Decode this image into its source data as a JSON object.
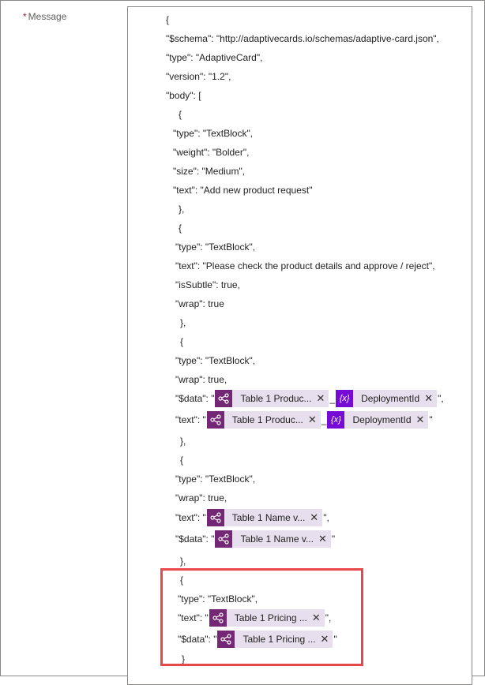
{
  "field": {
    "required_mark": "*",
    "label": "Message"
  },
  "lines": {
    "l1": "{",
    "l2": "\"$schema\": \"http://adaptivecards.io/schemas/adaptive-card.json\",",
    "l3": "\"type\": \"AdaptiveCard\",",
    "l4": "\"version\": \"1.2\",",
    "l5": "\"body\": [",
    "l6": "{",
    "l7": "\"type\": \"TextBlock\",",
    "l8": "\"weight\": \"Bolder\",",
    "l9": "\"size\": \"Medium\",",
    "l10": "\"text\": \"Add new product request\"",
    "l11": "},",
    "l12": "{",
    "l13": "\"type\": \"TextBlock\",",
    "l14": "\"text\": \"Please check the product details and approve / reject\",",
    "l15": "\"isSubtle\": true,",
    "l16": "\"wrap\": true",
    "l17": "},",
    "l18": "{",
    "l19": "\"type\": \"TextBlock\",",
    "l20": "\"wrap\": true,",
    "l21_pre": "\"$data\": \"",
    "l21_sep": "_",
    "l21_post": "\",",
    "l22_pre": "\"text\": \"",
    "l22_sep": "_",
    "l22_post": "\"",
    "l23": "},",
    "l24": "{",
    "l25": "\"type\": \"TextBlock\",",
    "l26": "\"wrap\": true,",
    "l27_pre": "\"text\": \"",
    "l27_post": "\",",
    "l28_pre": "\"$data\": \"",
    "l28_post": "\"",
    "l29": "},",
    "l30": "{",
    "l31": "\"type\": \"TextBlock\",",
    "l32_pre": "\"text\": \"",
    "l32_post": "\",",
    "l33_pre": "\"$data\": \"",
    "l33_post": "\"",
    "l34": "}"
  },
  "tokens": {
    "t1": {
      "label": "Table 1 Produc...",
      "icon": "flow-icon"
    },
    "t2": {
      "label": "DeploymentId",
      "icon": "variable-icon",
      "glyph": "{x}"
    },
    "t3": {
      "label": "Table 1 Produc...",
      "icon": "flow-icon"
    },
    "t4": {
      "label": "DeploymentId",
      "icon": "variable-icon",
      "glyph": "{x}"
    },
    "t5": {
      "label": "Table 1 Name v...",
      "icon": "flow-icon"
    },
    "t6": {
      "label": "Table 1 Name v...",
      "icon": "flow-icon"
    },
    "t7": {
      "label": "Table 1 Pricing ...",
      "icon": "flow-icon"
    },
    "t8": {
      "label": "Table 1 Pricing ...",
      "icon": "flow-icon"
    },
    "remove_glyph": "✕"
  },
  "colors": {
    "flow_icon": "#742774",
    "variable_icon": "#770bd6",
    "token_bg": "#e8dfee",
    "highlight": "#e8474c"
  }
}
